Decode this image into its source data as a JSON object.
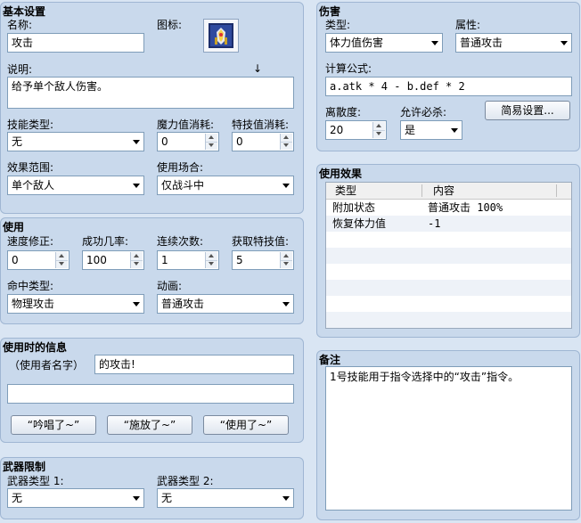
{
  "basic": {
    "title": "基本设置",
    "name_label": "名称:",
    "name_value": "攻击",
    "icon_label": "图标:",
    "desc_label": "说明:",
    "desc_value": "给予单个敌人伤害。",
    "skill_type_label": "技能类型:",
    "skill_type_value": "无",
    "mp_cost_label": "魔力值消耗:",
    "mp_cost_value": "0",
    "tp_cost_label": "特技值消耗:",
    "tp_cost_value": "0",
    "scope_label": "效果范围:",
    "scope_value": "单个敌人",
    "occasion_label": "使用场合:",
    "occasion_value": "仅战斗中"
  },
  "invocation": {
    "title": "使用",
    "speed_label": "速度修正:",
    "speed_value": "0",
    "success_label": "成功几率:",
    "success_value": "100",
    "repeat_label": "连续次数:",
    "repeat_value": "1",
    "tp_gain_label": "获取特技值:",
    "tp_gain_value": "5",
    "hit_type_label": "命中类型:",
    "hit_type_value": "物理攻击",
    "animation_label": "动画:",
    "animation_value": "普通攻击"
  },
  "message": {
    "title": "使用时的信息",
    "user_name_label": "（使用者名字）",
    "line1_value": "的攻击!",
    "line2_value": "",
    "btn_chant": "“吟唱了~”",
    "btn_cast": "“施放了~”",
    "btn_use": "“使用了~”"
  },
  "weapon": {
    "title": "武器限制",
    "type1_label": "武器类型 1:",
    "type1_value": "无",
    "type2_label": "武器类型 2:",
    "type2_value": "无"
  },
  "damage": {
    "title": "伤害",
    "type_label": "类型:",
    "type_value": "体力值伤害",
    "element_label": "属性:",
    "element_value": "普通攻击",
    "formula_label": "计算公式:",
    "formula_value": "a.atk * 4 - b.def * 2",
    "variance_label": "离散度:",
    "variance_value": "20",
    "critical_label": "允许必杀:",
    "critical_value": "是",
    "simple_button": "简易设置..."
  },
  "effects": {
    "title": "使用效果",
    "col_type": "类型",
    "col_content": "内容",
    "rows": [
      {
        "type": "附加状态",
        "content": "普通攻击 100%"
      },
      {
        "type": "恢复体力值",
        "content": "-1"
      }
    ]
  },
  "notes": {
    "title": "备注",
    "value": "1号技能用于指令选择中的“攻击”指令。"
  },
  "icon": {
    "name": "skill-icon"
  }
}
